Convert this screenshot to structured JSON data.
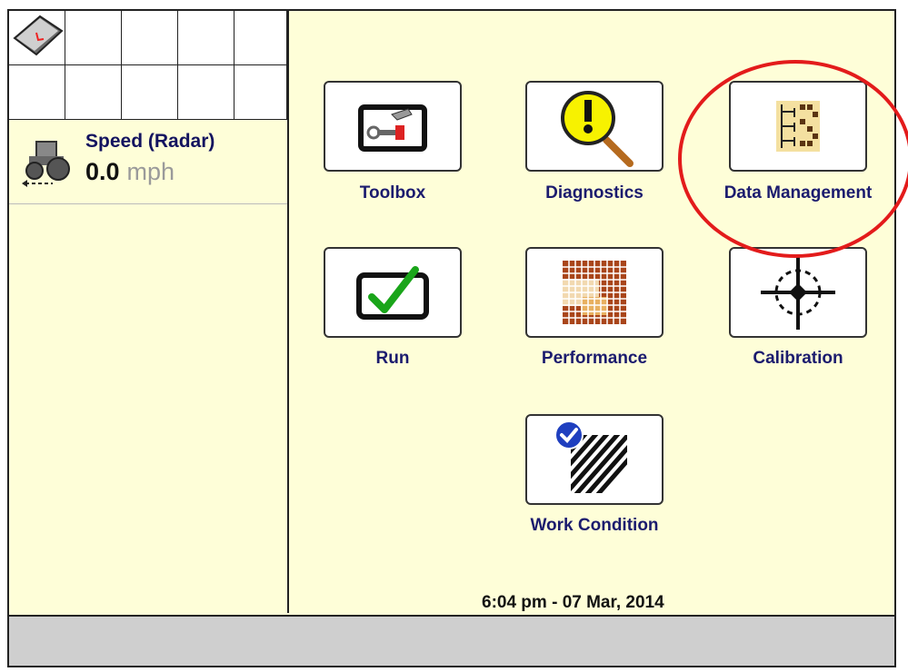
{
  "speed": {
    "label": "Speed (Radar)",
    "value": "0.0",
    "unit": "mph"
  },
  "menu": {
    "toolbox": "Toolbox",
    "diagnostics": "Diagnostics",
    "data_management": "Data Management",
    "run": "Run",
    "performance": "Performance",
    "calibration": "Calibration",
    "work_condition": "Work Condition"
  },
  "datetime": "6:04 pm - 07 Mar, 2014",
  "icons": {
    "toolbox": "toolbox-icon",
    "diagnostics": "magnifier-warning-icon",
    "data_management": "data-tree-icon",
    "run": "checkmark-icon",
    "performance": "grid-map-icon",
    "calibration": "crosshair-icon",
    "work_condition": "hatched-check-icon",
    "speed": "tractor-icon",
    "settings": "book-icon"
  },
  "colors": {
    "background": "#fefed8",
    "label": "#1b1b6e",
    "highlight": "#e31b1b"
  }
}
